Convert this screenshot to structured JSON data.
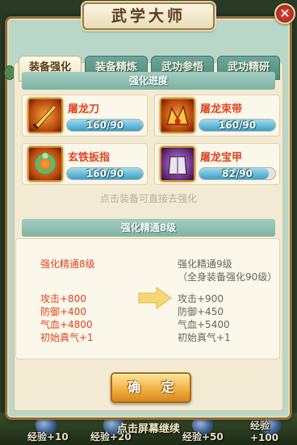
{
  "window": {
    "title": "武学大师",
    "close_icon": "close-icon"
  },
  "tabs": [
    {
      "label": "装备强化",
      "active": true
    },
    {
      "label": "装备精炼",
      "active": false
    },
    {
      "label": "武功参悟",
      "active": false
    },
    {
      "label": "武功精研",
      "active": false
    }
  ],
  "progress_section": {
    "header": "强化进度",
    "items": [
      {
        "name": "屠龙刀",
        "icon": "dragon-blade-icon",
        "progress_text": "160/90",
        "fill": 1.0
      },
      {
        "name": "屠龙束带",
        "icon": "dragon-belt-icon",
        "progress_text": "160/90",
        "fill": 1.0
      },
      {
        "name": "玄铁扳指",
        "icon": "iron-thumb-ring-icon",
        "progress_text": "160/90",
        "fill": 1.0
      },
      {
        "name": "屠龙宝甲",
        "icon": "dragon-armor-icon",
        "progress_text": "82/90",
        "fill": 0.91
      }
    ],
    "hint": "点击装备可直接去强化"
  },
  "mastery_section": {
    "header": "强化精通8级",
    "current": {
      "title": "强化精通8级",
      "stats": [
        "攻击+800",
        "防御+400",
        "气血+4800",
        "初始真气+1"
      ]
    },
    "next": {
      "title": "强化精通9级",
      "subtitle": "（全身装备强化90级）",
      "stats": [
        "攻击+900",
        "防御+450",
        "气血+5400",
        "初始真气+1"
      ]
    }
  },
  "confirm_label": "确 定",
  "continue_hint": "点击屏幕继续",
  "background_exp": [
    "经验+10",
    "经验+20",
    "经验+50",
    "经验+100"
  ],
  "colors": {
    "accent_red": "#e04420",
    "progress_blue": "#3a9fc7",
    "button_gold": "#f2b243"
  }
}
